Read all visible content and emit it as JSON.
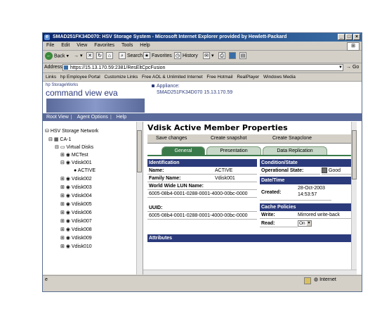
{
  "window": {
    "title": "SMAD251FK34D070: HSV Storage System - Microsoft Internet Explorer provided by Hewlett-Packard",
    "controls": [
      "_",
      "×"
    ]
  },
  "menu": [
    "File",
    "Edit",
    "View",
    "Favorites",
    "Tools",
    "Help"
  ],
  "toolbar": {
    "back": "Back",
    "search": "Search",
    "favorites": "Favorites",
    "history": "History"
  },
  "address": {
    "label": "Address",
    "url": "https://15.13.170.59:2381/ResEltCpcFusion",
    "go": "Go"
  },
  "links": {
    "label": "Links",
    "items": [
      "hp Employee Portal",
      "Customize Links",
      "Free AOL & Unlimited Internet",
      "Free Hotmail",
      "RealPlayer",
      "Windows Media"
    ]
  },
  "banner": {
    "hp": "hp StorageWorks",
    "brand": "command view eva",
    "appliance_label": "Appliance:",
    "appliance_value": "SMAD251FK34D070 15.13.170.59"
  },
  "nav": [
    "Root View",
    "Agent Options",
    "Help"
  ],
  "tree": {
    "root": "HSV Storage Network",
    "ca": "CA-1",
    "vd": "Virtual Disks",
    "mctest": "MCTest",
    "v1": "Vdisk001",
    "active": "ACTIVE",
    "v2": "Vdisk002",
    "v3": "Vdisk003",
    "v4": "Vdisk004",
    "v5": "Vdisk005",
    "v6": "Vdisk006",
    "v7": "Vdisk007",
    "v8": "Vdisk008",
    "v9": "Vdisk009",
    "v10": "Vdisk010"
  },
  "page": {
    "title": "Vdisk Active Member Properties",
    "buttons": {
      "save": "Save changes",
      "snapshot": "Create snapshot",
      "snapclone": "Create Snapclone"
    },
    "tabs": {
      "general": "General",
      "presentation": "Presentation",
      "replication": "Data Replication"
    },
    "identification": {
      "header": "Identification",
      "name_label": "Name:",
      "name_value": "ACTIVE",
      "family_label": "Family Name:",
      "family_value": "Vdisk001",
      "wwlun_label": "World Wide LUN Name:",
      "wwlun_value": "6005-08b4-0001-0288-0001-4000-00bc-0000",
      "uuid_label": "UUID:",
      "uuid_value": "6005-08b4-0001-0288-0001-4000-00bc-0000"
    },
    "condition": {
      "header": "Condition/State",
      "op_label": "Operational State:",
      "op_value": "Good"
    },
    "datetime": {
      "header": "Date/Time",
      "created_label": "Created:",
      "created_value": "28-Oct-2003 14:53:57"
    },
    "cache": {
      "header": "Cache Policies",
      "write_label": "Write:",
      "write_value": "Mirrored write-back",
      "read_label": "Read:",
      "read_value": "On"
    },
    "attributes_header": "Attributes"
  },
  "status": {
    "zone": "Internet"
  }
}
